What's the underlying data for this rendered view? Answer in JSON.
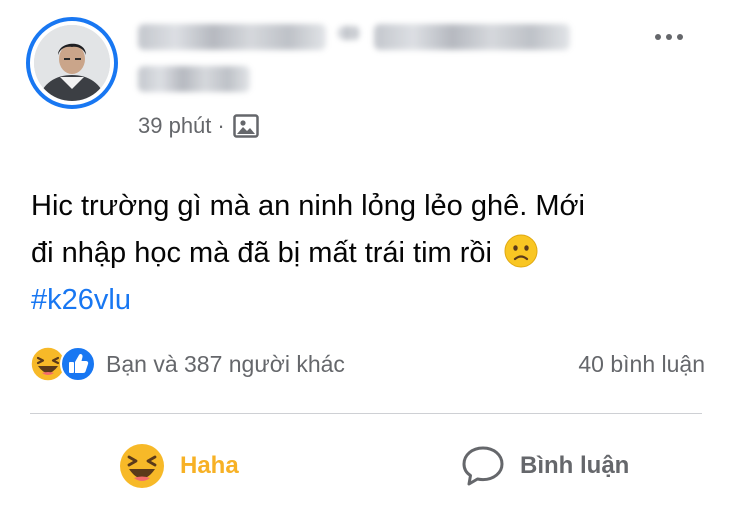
{
  "post": {
    "timestamp": "39 phút",
    "separator": "·",
    "audience_icon": "image-icon",
    "text_line1": "Hic trường gì mà an ninh lỏng lẻo ghê. Mới",
    "text_line2": "đi nhập học mà đã bị mất trái tim rồi",
    "emoji": "sad-face",
    "hashtag": "#k26vlu"
  },
  "reactions": {
    "icons": [
      "haha-icon",
      "like-icon"
    ],
    "summary": "Bạn và 387 người khác",
    "comments": "40 bình luận"
  },
  "actions": {
    "haha_label": "Haha",
    "comment_label": "Bình luận"
  },
  "colors": {
    "accent": "#1877f2",
    "haha": "#f7b125",
    "secondary_text": "#65676b",
    "divider": "#ced0d4"
  }
}
